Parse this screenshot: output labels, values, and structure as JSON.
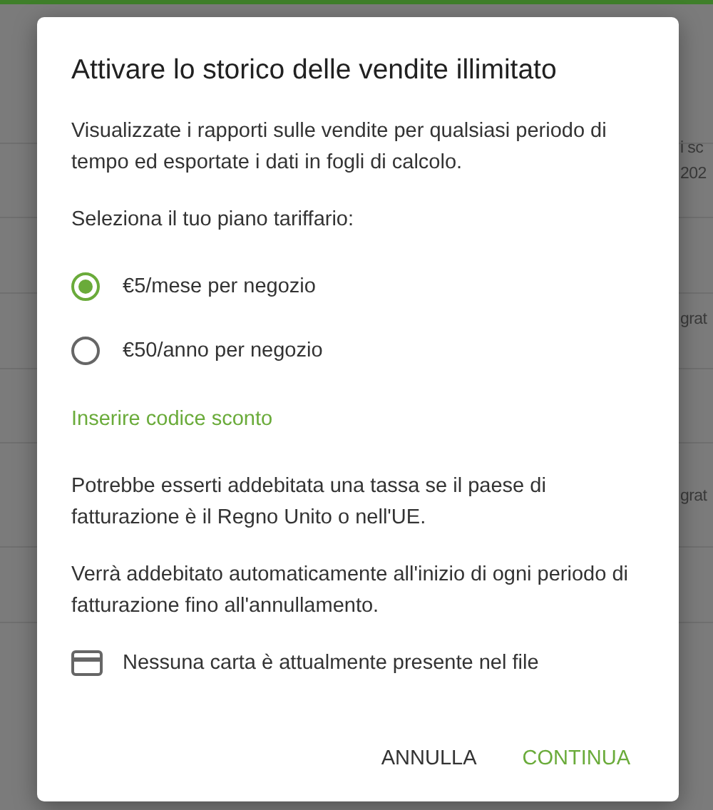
{
  "background": {
    "fragments": [
      "i sc",
      "202",
      "grat",
      "grat"
    ]
  },
  "dialog": {
    "title": "Attivare lo storico delle vendite illimitato",
    "intro": "Visualizzate i rapporti sulle vendite per qualsiasi periodo di tempo ed esportate i dati in fogli di calcolo.",
    "plan_prompt": "Seleziona il tuo piano tariffario:",
    "plans": [
      {
        "label": "€5/mese per negozio",
        "selected": true
      },
      {
        "label": "€50/anno per negozio",
        "selected": false
      }
    ],
    "discount_link": "Inserire codice sconto",
    "notes": [
      "Potrebbe esserti addebitata una tassa se il paese di fatturazione è il Regno Unito o nell'UE.",
      "Verrà addebitato automaticamente all'inizio di ogni periodo di fatturazione fino all'annullamento."
    ],
    "card_status": "Nessuna carta è attualmente presente nel file",
    "buttons": [
      {
        "label": "ANNULLA",
        "kind": "secondary"
      },
      {
        "label": "CONTINUA",
        "kind": "primary"
      }
    ]
  }
}
